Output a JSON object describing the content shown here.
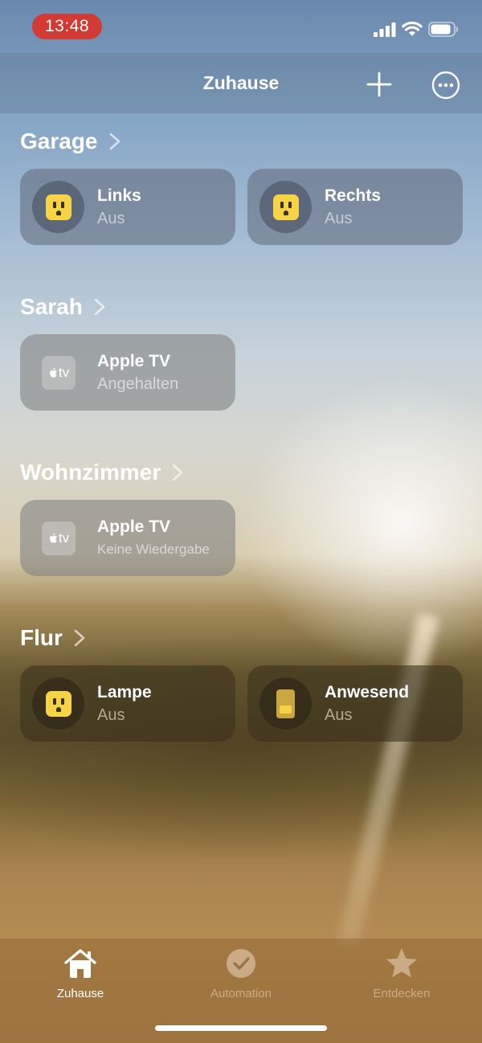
{
  "status_bar": {
    "time": "13:48",
    "time_pill_color": "#d13b34"
  },
  "header": {
    "title": "Zuhause",
    "add_icon": "plus-icon",
    "more_icon": "ellipsis-circle-icon"
  },
  "sections": [
    {
      "title": "Garage",
      "tiles": [
        {
          "name": "Links",
          "state": "Aus",
          "icon": "outlet-icon"
        },
        {
          "name": "Rechts",
          "state": "Aus",
          "icon": "outlet-icon"
        }
      ]
    },
    {
      "title": "Sarah",
      "tiles": [
        {
          "name": "Apple TV",
          "state": "Angehalten",
          "icon": "apple-tv-icon",
          "icon_text": "tv"
        }
      ]
    },
    {
      "title": "Wohnzimmer",
      "tiles": [
        {
          "name": "Apple TV",
          "state": "Keine Wiedergabe",
          "icon": "apple-tv-icon",
          "icon_text": "tv"
        }
      ]
    },
    {
      "title": "Flur",
      "tiles": [
        {
          "name": "Lampe",
          "state": "Aus",
          "icon": "outlet-icon"
        },
        {
          "name": "Anwesend",
          "state": "Aus",
          "icon": "sensor-icon"
        }
      ]
    }
  ],
  "tabbar": {
    "tabs": [
      {
        "label": "Zuhause",
        "icon": "house-icon",
        "active": true
      },
      {
        "label": "Automation",
        "icon": "clock-check-icon",
        "active": false
      },
      {
        "label": "Entdecken",
        "icon": "star-icon",
        "active": false
      }
    ]
  },
  "colors": {
    "accessory_yellow": "#f6d445"
  }
}
